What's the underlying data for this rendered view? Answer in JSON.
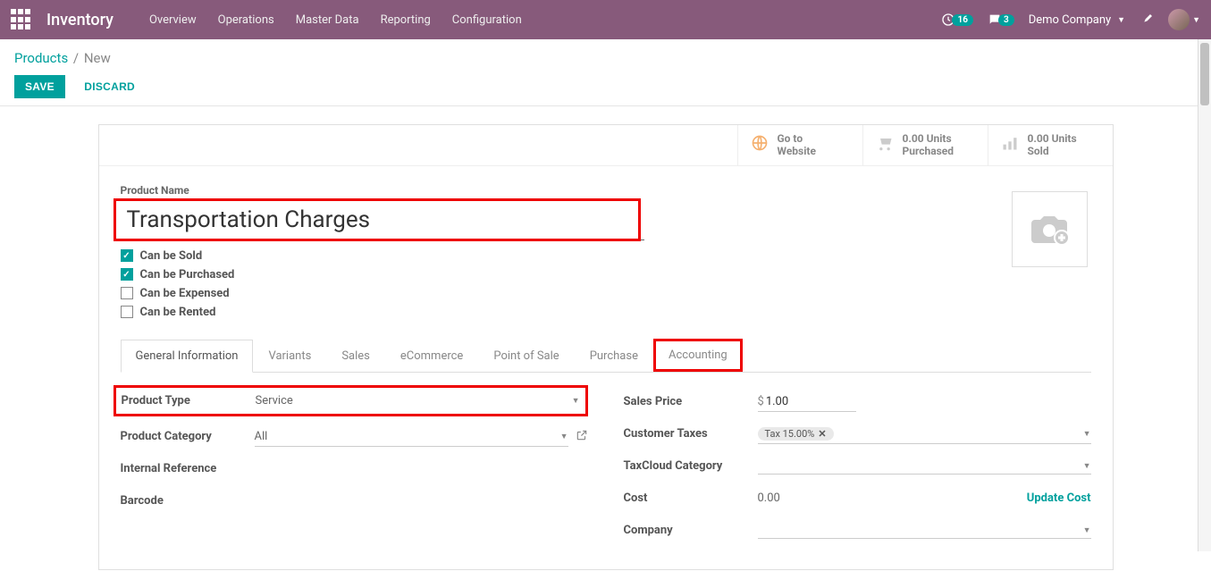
{
  "nav": {
    "app_title": "Inventory",
    "menu": [
      "Overview",
      "Operations",
      "Master Data",
      "Reporting",
      "Configuration"
    ],
    "clock_badge": "16",
    "chat_badge": "3",
    "company": "Demo Company"
  },
  "breadcrumb": {
    "root": "Products",
    "current": "New"
  },
  "buttons": {
    "save": "SAVE",
    "discard": "DISCARD"
  },
  "stats": {
    "website": {
      "line1": "Go to",
      "line2": "Website"
    },
    "purchased": {
      "line1": "0.00 Units",
      "line2": "Purchased"
    },
    "sold": {
      "line1": "0.00 Units",
      "line2": "Sold"
    }
  },
  "product": {
    "name_label": "Product Name",
    "name": "Transportation Charges",
    "checks": {
      "sold": {
        "label": "Can be Sold",
        "checked": true
      },
      "purchased": {
        "label": "Can be Purchased",
        "checked": true
      },
      "expensed": {
        "label": "Can be Expensed",
        "checked": false
      },
      "rented": {
        "label": "Can be Rented",
        "checked": false
      }
    }
  },
  "tabs": [
    "General Information",
    "Variants",
    "Sales",
    "eCommerce",
    "Point of Sale",
    "Purchase",
    "Accounting"
  ],
  "fields": {
    "product_type": {
      "label": "Product Type",
      "value": "Service"
    },
    "product_category": {
      "label": "Product Category",
      "value": "All"
    },
    "internal_ref": {
      "label": "Internal Reference",
      "value": ""
    },
    "barcode": {
      "label": "Barcode",
      "value": ""
    },
    "sales_price": {
      "label": "Sales Price",
      "currency": "$",
      "value": "1.00"
    },
    "customer_taxes": {
      "label": "Customer Taxes",
      "tag": "Tax 15.00%"
    },
    "taxcloud": {
      "label": "TaxCloud Category",
      "value": ""
    },
    "cost": {
      "label": "Cost",
      "value": "0.00",
      "action": "Update Cost"
    },
    "company": {
      "label": "Company",
      "value": ""
    }
  }
}
